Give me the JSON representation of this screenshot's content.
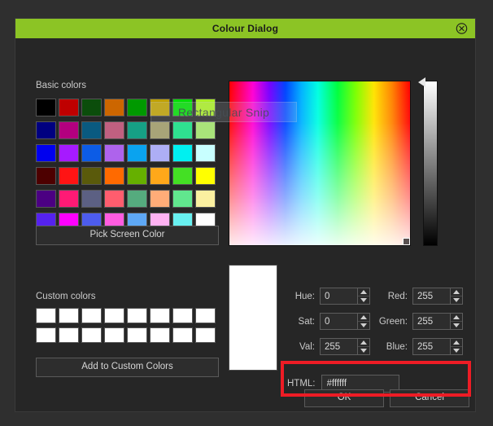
{
  "window": {
    "title": "Colour Dialog",
    "titlebar_color": "#8cc425",
    "titlebar_text_color": "#1b1b1b",
    "background_color": "#262626",
    "close_icon": "close-circle-icon"
  },
  "basic_colors": {
    "label": "Basic colors",
    "rows": [
      [
        "#000000",
        "#bf0000",
        "#0b4d0b",
        "#cc6600",
        "#009900",
        "#bfa000",
        "#00dd00",
        "#aaee22"
      ],
      [
        "#000080",
        "#b3007f",
        "#0a5a80",
        "#c06080",
        "#16a085",
        "#a8a478",
        "#2fe090",
        "#a9e37a"
      ],
      [
        "#0000ee",
        "#a61aff",
        "#0c5ce6",
        "#ae63ec",
        "#0aa3ef",
        "#adaef5",
        "#00f0f0",
        "#c8ffff"
      ],
      [
        "#4d0000",
        "#ff1414",
        "#5a5a0b",
        "#ff6a00",
        "#66b000",
        "#ffa81a",
        "#44e024",
        "#ffff00"
      ],
      [
        "#4b0082",
        "#ff1a75",
        "#5c6083",
        "#ff5d6e",
        "#55ab7e",
        "#ffac78",
        "#61e68e",
        "#fbf0a0"
      ],
      [
        "#5522ee",
        "#ff00ff",
        "#4d5ced",
        "#ff5ce0",
        "#5ea8f5",
        "#ffb2f2",
        "#68f0f0",
        "#ffffff"
      ]
    ]
  },
  "custom_colors": {
    "label": "Custom colors",
    "swatch_color": "#ffffff",
    "columns": 8,
    "rows": 2
  },
  "buttons": {
    "pick_screen_color": "Pick Screen Color",
    "add_to_custom_colors": "Add to Custom Colors",
    "ok": "OK",
    "cancel": "Cancel"
  },
  "color_fields": {
    "hue": {
      "label": "Hue:",
      "value": "0"
    },
    "sat": {
      "label": "Sat:",
      "value": "0"
    },
    "val": {
      "label": "Val:",
      "value": "255"
    },
    "red": {
      "label": "Red:",
      "value": "255"
    },
    "green": {
      "label": "Green:",
      "value": "255"
    },
    "blue": {
      "label": "Blue:",
      "value": "255"
    }
  },
  "html_field": {
    "label": "HTML:",
    "value": "#ffffff",
    "placeholder": "#ffffff"
  },
  "preview": {
    "current_color": "#ffffff"
  },
  "annotation": {
    "highlight_color": "#ee1c25"
  },
  "overlay": {
    "snip_label": "Rectangular Snip"
  }
}
